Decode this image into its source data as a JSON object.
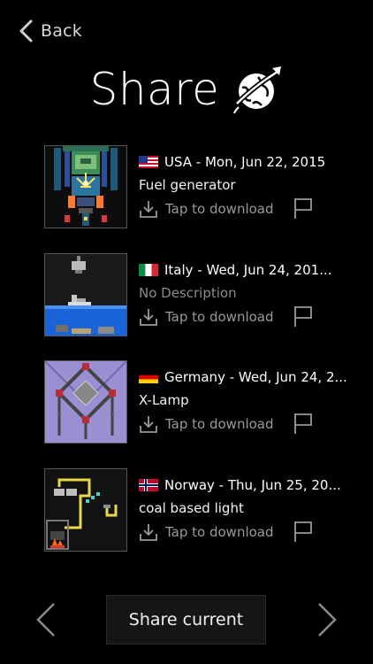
{
  "header": {
    "back_label": "Back",
    "title": "Share",
    "title_icon": "globe-rocket-icon"
  },
  "items": [
    {
      "flag": "us-flag-icon",
      "headline": "USA - Mon, Jun 22, 2015",
      "description": "Fuel generator",
      "download_label": "Tap to download",
      "report_icon": "flag-outline-icon"
    },
    {
      "flag": "it-flag-icon",
      "headline": "Italy - Wed, Jun 24, 201...",
      "description": "No Description",
      "download_label": "Tap to download",
      "report_icon": "flag-outline-icon"
    },
    {
      "flag": "de-flag-icon",
      "headline": "Germany - Wed, Jun 24, 2...",
      "description": "X-Lamp",
      "download_label": "Tap to download",
      "report_icon": "flag-outline-icon"
    },
    {
      "flag": "no-flag-icon",
      "headline": "Norway - Thu, Jun 25, 20...",
      "description": "coal based light",
      "download_label": "Tap to download",
      "report_icon": "flag-outline-icon"
    }
  ],
  "footer": {
    "share_label": "Share current",
    "prev_icon": "chevron-left-icon",
    "next_icon": "chevron-right-icon"
  },
  "colors": {
    "background": "#000000",
    "text": "#ffffff",
    "muted": "#9a9a9a"
  }
}
